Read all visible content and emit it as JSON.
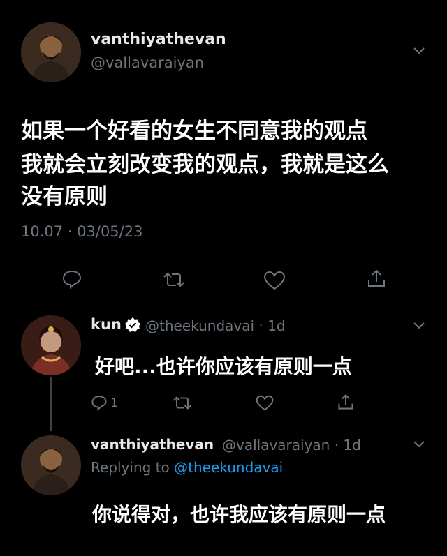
{
  "main_tweet": {
    "display_name": "vanthiyathevan",
    "handle": "@vallavaraiyan",
    "text_line1": "如果一个好看的女生不同意我的观点",
    "text_line2": "我就会立刻改变我的观点，我就是这么",
    "text_line3": "没有原则",
    "timestamp": "10.07 · 03/05/23"
  },
  "reply1": {
    "display_name": "kun",
    "handle_meta": "@theekundavai · 1d",
    "text": "好吧...也许你应该有原则一点",
    "reply_count": "1"
  },
  "reply2": {
    "display_name": "vanthiyathevan",
    "handle_meta": "@vallavaraiyan · 1d",
    "replying_prefix": "Replying to ",
    "replying_handle": "@theekundavai",
    "text": "你说得对，也许我应该有原则一点"
  },
  "colors": {
    "background": "#000000",
    "muted": "#6e767d",
    "link": "#1d9bf0",
    "verified": "#ffffff"
  },
  "icons": [
    "chevron-down-icon",
    "reply-icon",
    "retweet-icon",
    "like-icon",
    "share-icon",
    "verified-icon"
  ]
}
